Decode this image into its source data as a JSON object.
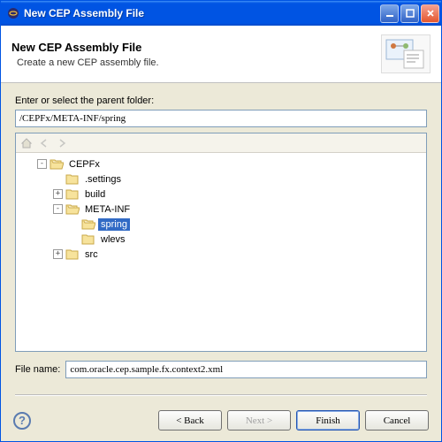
{
  "titlebar": {
    "title": "New CEP Assembly File"
  },
  "banner": {
    "title": "New CEP Assembly File",
    "subtitle": "Create a new CEP assembly file."
  },
  "parent_folder": {
    "label": "Enter or select the parent folder:",
    "value": "/CEPFx/META-INF/spring"
  },
  "tree": {
    "items": [
      {
        "label": "CEPFx",
        "depth": 0,
        "expander": "-",
        "open": true,
        "selected": false
      },
      {
        "label": ".settings",
        "depth": 1,
        "expander": "",
        "open": false,
        "selected": false
      },
      {
        "label": "build",
        "depth": 1,
        "expander": "+",
        "open": false,
        "selected": false
      },
      {
        "label": "META-INF",
        "depth": 1,
        "expander": "-",
        "open": true,
        "selected": false
      },
      {
        "label": "spring",
        "depth": 2,
        "expander": "",
        "open": true,
        "selected": true
      },
      {
        "label": "wlevs",
        "depth": 2,
        "expander": "",
        "open": false,
        "selected": false
      },
      {
        "label": "src",
        "depth": 1,
        "expander": "+",
        "open": false,
        "selected": false
      }
    ]
  },
  "filename": {
    "label": "File name:",
    "value": "com.oracle.cep.sample.fx.context2.xml"
  },
  "buttons": {
    "back": "< Back",
    "next": "Next >",
    "finish": "Finish",
    "cancel": "Cancel"
  }
}
